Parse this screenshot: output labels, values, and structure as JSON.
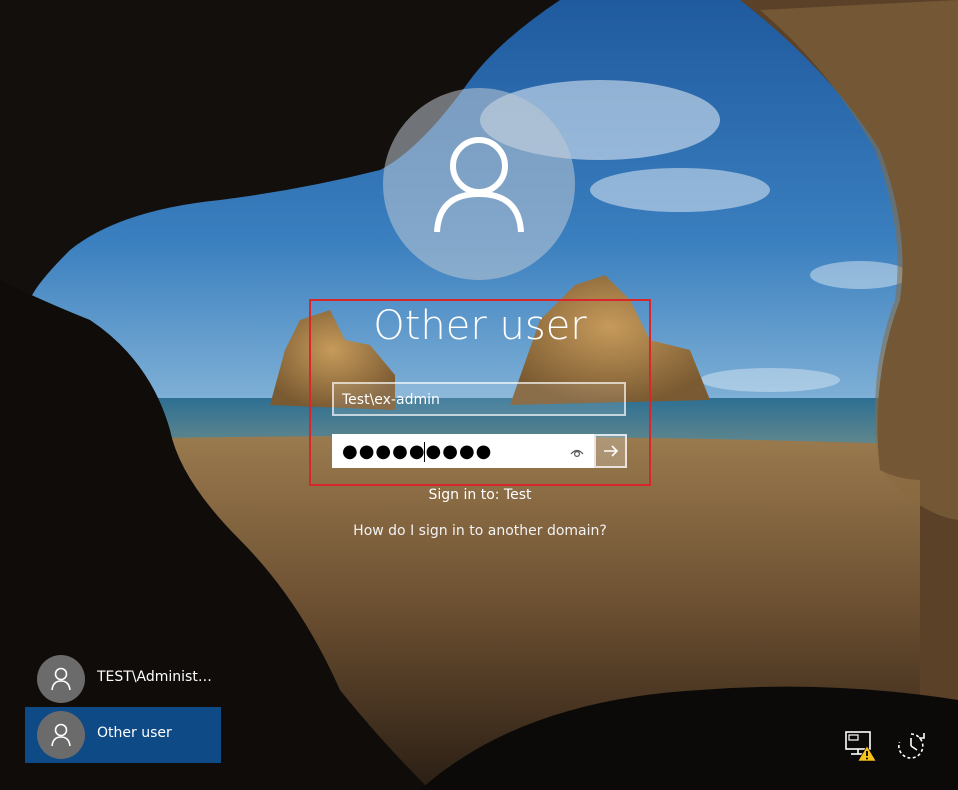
{
  "login": {
    "title": "Other user",
    "username_value": "Test\\ex-admin",
    "password_mask": "●●●●●●●●●",
    "sign_in_domain": "Sign in to: Test",
    "help_link": "How do I sign in to another domain?"
  },
  "users": [
    {
      "label": "TEST\\Administr…",
      "selected": false
    },
    {
      "label": "Other user",
      "selected": true
    }
  ],
  "tray": {
    "network_icon": "network-warning-icon",
    "accessibility_icon": "ease-of-access-icon"
  },
  "colors": {
    "selected_tile": "#0d4a86",
    "highlight_border": "#d9262b"
  }
}
